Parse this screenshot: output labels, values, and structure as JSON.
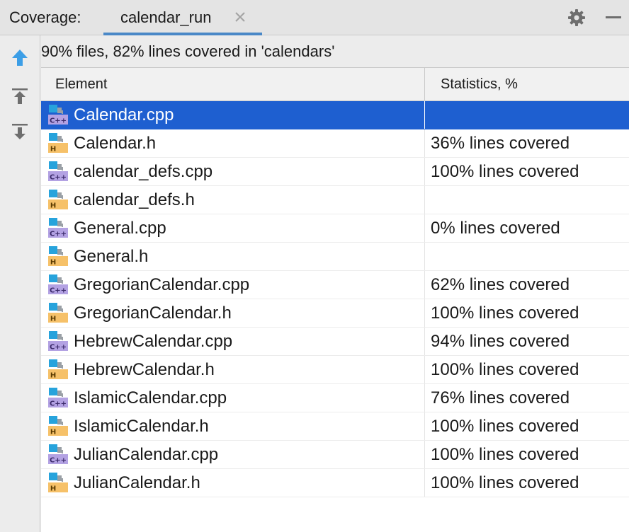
{
  "header": {
    "label": "Coverage:",
    "tab": "calendar_run"
  },
  "toolbar": {
    "icons": [
      "up-arrow-icon",
      "collapse-up-icon",
      "expand-down-icon"
    ]
  },
  "summary": "90% files, 82% lines covered in 'calendars'",
  "table": {
    "columns": [
      "Element",
      "Statistics, %"
    ],
    "rows": [
      {
        "name": "Calendar.cpp",
        "type": "cpp",
        "stat": "",
        "selected": true
      },
      {
        "name": "Calendar.h",
        "type": "h",
        "stat": "36% lines covered"
      },
      {
        "name": "calendar_defs.cpp",
        "type": "cpp",
        "stat": "100% lines covered"
      },
      {
        "name": "calendar_defs.h",
        "type": "h",
        "stat": ""
      },
      {
        "name": "General.cpp",
        "type": "cpp",
        "stat": "0% lines covered"
      },
      {
        "name": "General.h",
        "type": "h",
        "stat": ""
      },
      {
        "name": "GregorianCalendar.cpp",
        "type": "cpp",
        "stat": "62% lines covered"
      },
      {
        "name": "GregorianCalendar.h",
        "type": "h",
        "stat": "100% lines covered"
      },
      {
        "name": "HebrewCalendar.cpp",
        "type": "cpp",
        "stat": "94% lines covered"
      },
      {
        "name": "HebrewCalendar.h",
        "type": "h",
        "stat": "100% lines covered"
      },
      {
        "name": "IslamicCalendar.cpp",
        "type": "cpp",
        "stat": "76% lines covered"
      },
      {
        "name": "IslamicCalendar.h",
        "type": "h",
        "stat": "100% lines covered"
      },
      {
        "name": "JulianCalendar.cpp",
        "type": "cpp",
        "stat": "100% lines covered"
      },
      {
        "name": "JulianCalendar.h",
        "type": "h",
        "stat": "100% lines covered"
      }
    ]
  },
  "icon_text": {
    "cpp": "C++",
    "h": "H"
  },
  "colors": {
    "selection": "#1e5fd0",
    "tab_underline": "#4a88c7",
    "cpp_badge": "#b3a2e3",
    "h_badge": "#f6c169",
    "file_square": "#27a3dc",
    "file_gray": "#9aa0a6"
  }
}
